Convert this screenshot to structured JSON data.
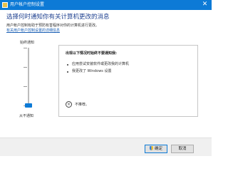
{
  "window": {
    "title": "用户帐户控制设置",
    "close_glyph": "✕"
  },
  "header": {
    "heading": "选择何时通知你有关计算机更改的消息",
    "description": "用户帐户控制有助于预防有害程序对你的计算机进行更改。",
    "link": "有关用户帐户控制设置的详细信息"
  },
  "slider": {
    "top_label": "始终通知",
    "bottom_label": "从不通知",
    "level": 0,
    "levels": 4
  },
  "panel": {
    "title": "出现以下情况时始终不要通知我:",
    "bullets": [
      "应用尝试安装软件或更改我的计算机",
      "我更改了 Windows 设置"
    ],
    "recommendation": "不推荐。"
  },
  "footer": {
    "ok_label": "确定",
    "cancel_label": "取消"
  },
  "colors": {
    "accent": "#0d7ad6",
    "heading": "#1c3f8f",
    "link": "#1a5fb4"
  }
}
